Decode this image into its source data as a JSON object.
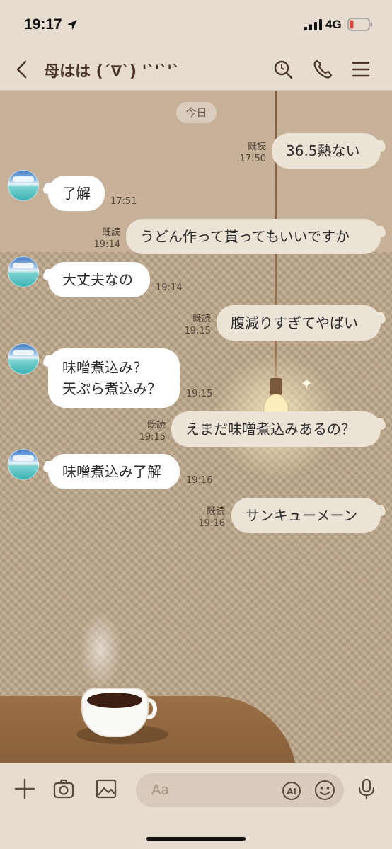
{
  "status_bar": {
    "time": "19:17",
    "network": "4G"
  },
  "header": {
    "title": "母はは (´∇`) '`'`'`"
  },
  "chat": {
    "date_divider": "今日",
    "messages": [
      {
        "dir": "out",
        "text": "36.5熱ない",
        "read": "既読",
        "time": "17:50"
      },
      {
        "dir": "in",
        "text": "了解",
        "time": "17:51"
      },
      {
        "dir": "out",
        "text": "うどん作って貰ってもいいですか",
        "read": "既読",
        "time": "19:14"
      },
      {
        "dir": "in",
        "text": "大丈夫なの",
        "time": "19:14"
      },
      {
        "dir": "out",
        "text": "腹減りすぎてやばい",
        "read": "既読",
        "time": "19:15"
      },
      {
        "dir": "in",
        "text_line1": "味噌煮込み？",
        "text_line2": "天ぷら煮込み？",
        "time": "19:15"
      },
      {
        "dir": "out",
        "text": "えまだ味噌煮込みあるの？",
        "read": "既読",
        "time": "19:15"
      },
      {
        "dir": "in",
        "text": "味噌煮込み了解",
        "time": "19:16"
      },
      {
        "dir": "out",
        "text": "サンキューメーン",
        "read": "既読",
        "time": "19:16"
      }
    ]
  },
  "input_bar": {
    "placeholder": "Aa",
    "ai_label": "AI"
  },
  "icons": [
    "location-arrow-icon",
    "signal-icon",
    "battery-icon",
    "back-icon",
    "search-icon",
    "phone-icon",
    "menu-icon",
    "plus-icon",
    "camera-icon",
    "image-icon",
    "ai-icon",
    "emoji-icon",
    "mic-icon"
  ],
  "colors": {
    "background": "#e6dccf",
    "outgoing_bubble": "#ece3d7",
    "incoming_bubble": "#ffffff",
    "battery_low": "#e0463e"
  }
}
